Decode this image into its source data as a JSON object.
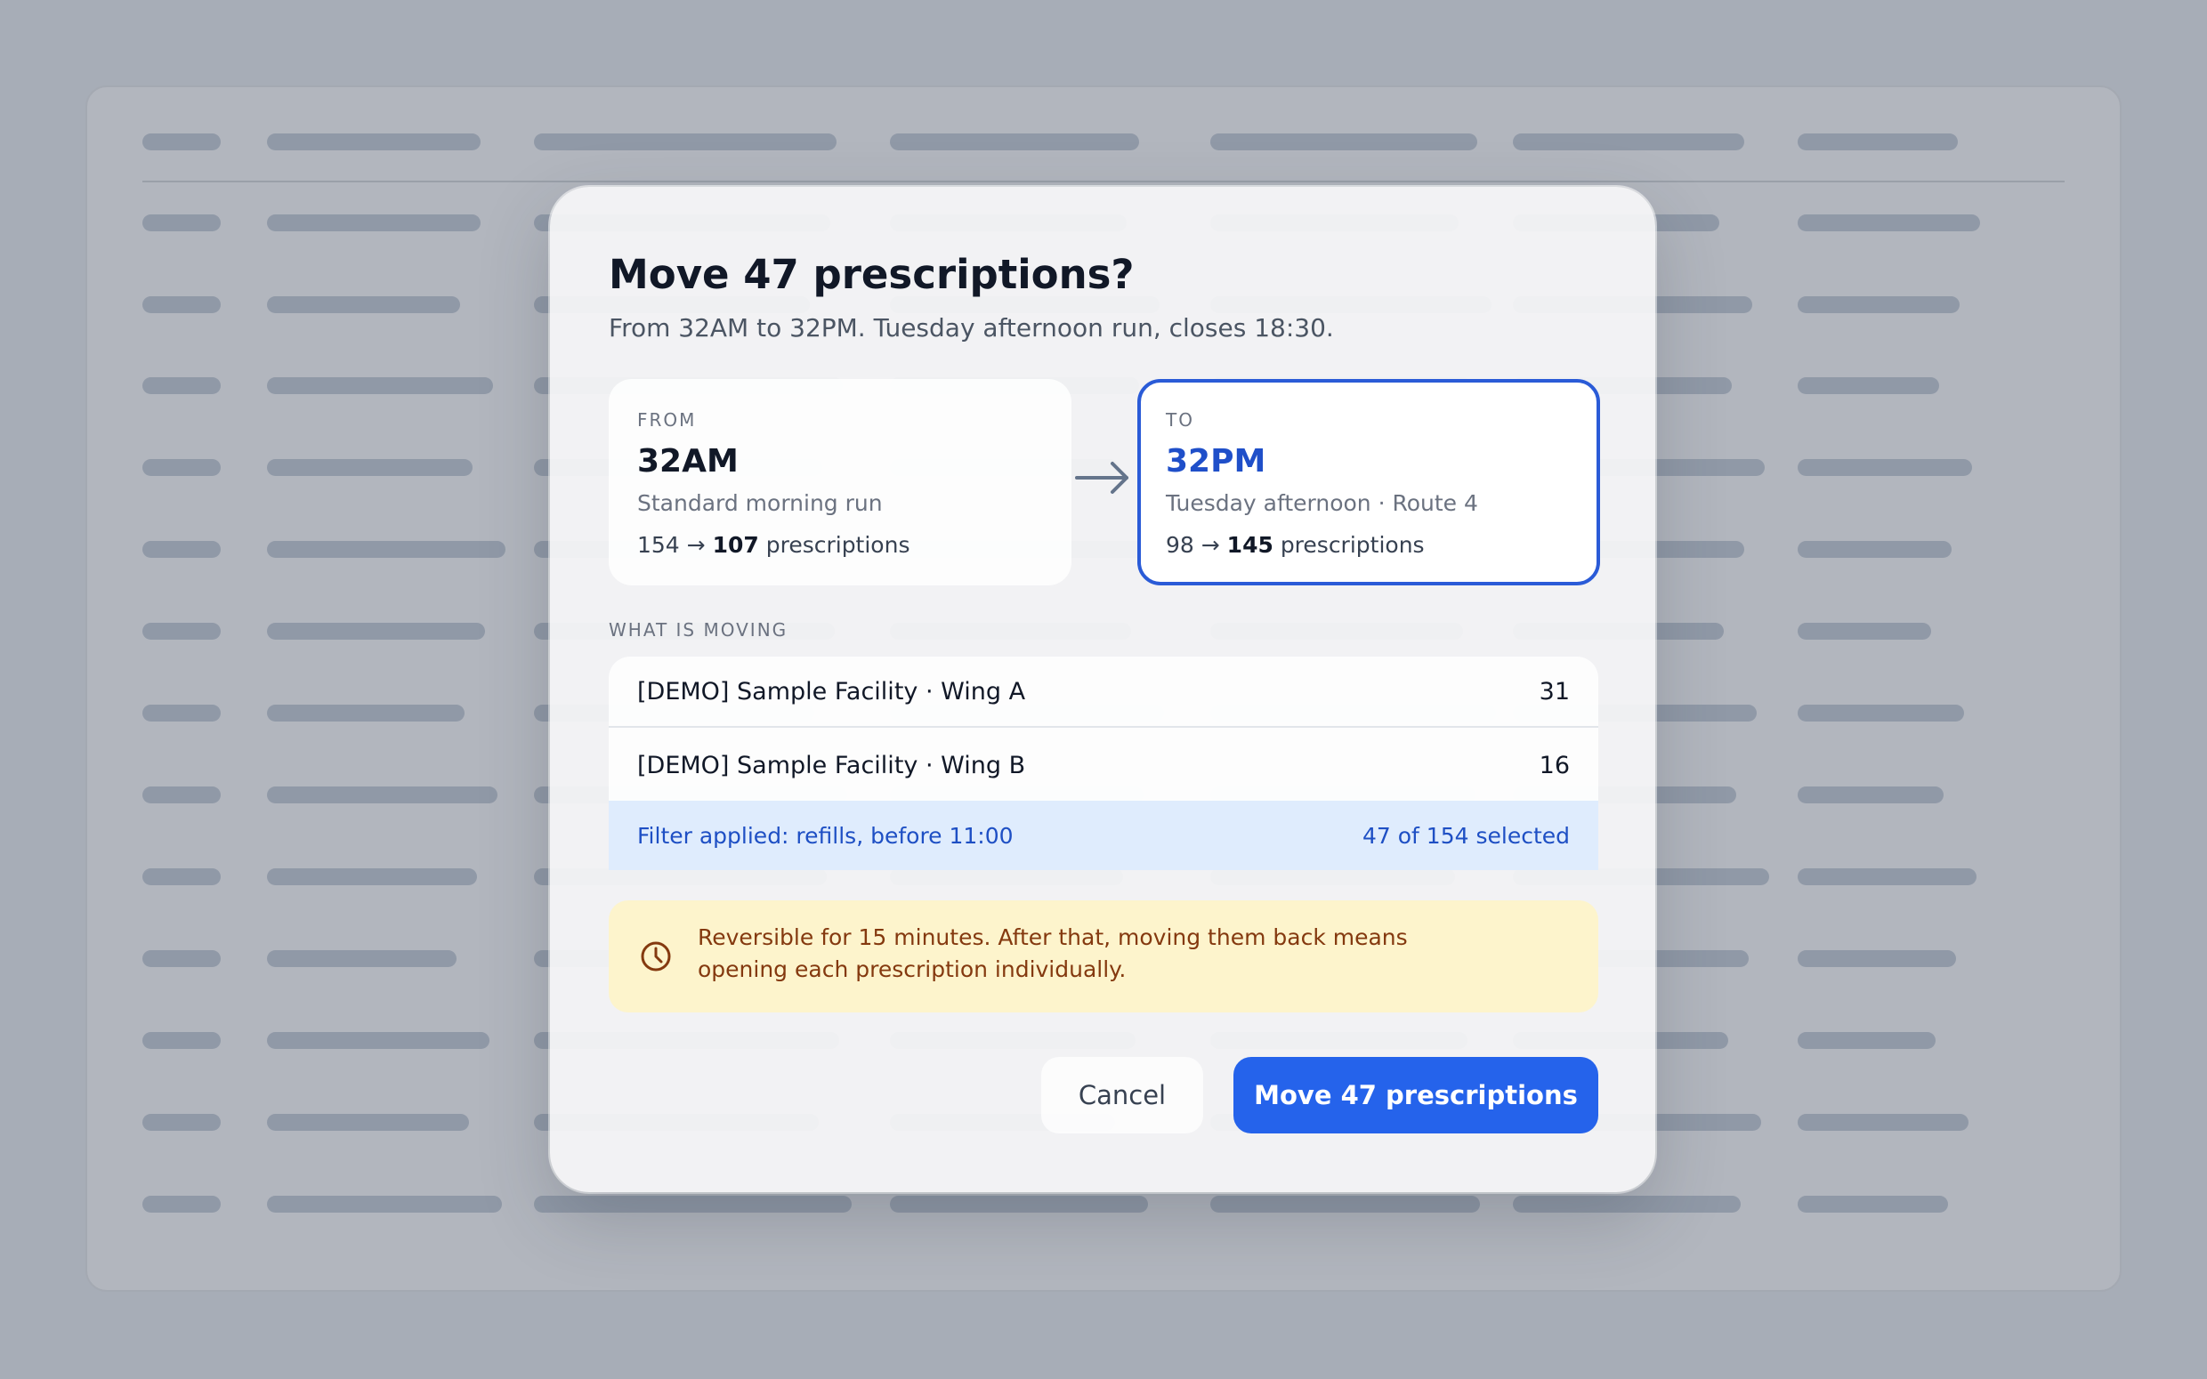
{
  "dialog": {
    "title": "Move 47 prescriptions?",
    "subtitle": "From 32AM to 32PM. Tuesday afternoon run, closes 18:30."
  },
  "from_card": {
    "label": "FROM",
    "name": "32AM",
    "description": "Standard morning run",
    "count_before": "154",
    "arrow": "→",
    "count_after": "107",
    "count_suffix": "prescriptions"
  },
  "to_card": {
    "label": "TO",
    "name": "32PM",
    "description": "Tuesday afternoon · Route 4",
    "count_before": "98",
    "arrow": "→",
    "count_after": "145",
    "count_suffix": "prescriptions"
  },
  "moving": {
    "label": "WHAT IS MOVING",
    "rows": [
      {
        "name": "[DEMO] Sample Facility · Wing A",
        "count": "31"
      },
      {
        "name": "[DEMO] Sample Facility · Wing B",
        "count": "16"
      }
    ],
    "filter_text": "Filter applied: refills, before 11:00",
    "selection_text": "47 of 154 selected"
  },
  "warning": {
    "icon": "clock-icon",
    "line1": "Reversible for 15 minutes. After that, moving them back means",
    "line2": "opening each prescription individually."
  },
  "buttons": {
    "cancel": "Cancel",
    "confirm": "Move 47 prescriptions"
  },
  "colors": {
    "primary": "#2563eb",
    "to_accent": "#1f4fc9",
    "warning_bg": "#fdf4cc",
    "warning_text": "#84390f",
    "filter_bg": "#dfecfd"
  }
}
